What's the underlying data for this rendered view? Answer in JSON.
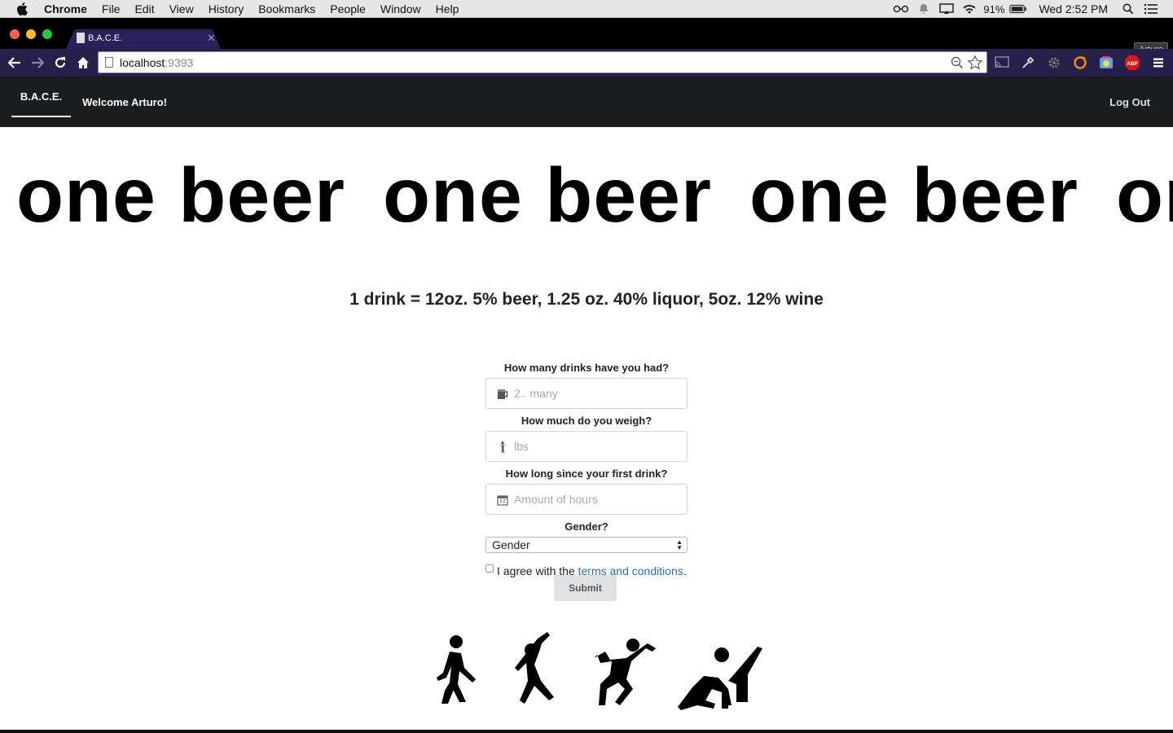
{
  "os_menu": {
    "app": "Chrome",
    "items": [
      "File",
      "Edit",
      "View",
      "History",
      "Bookmarks",
      "People",
      "Window",
      "Help"
    ],
    "battery": "91%",
    "clock": "Wed 2:52 PM"
  },
  "browser": {
    "tab_title": "B.A.C.E.",
    "profile": "Arturo",
    "url_host": "localhost",
    "url_port": ":9393"
  },
  "nav": {
    "brand": "B.A.C.E.",
    "welcome": "Welcome Arturo!",
    "logout": "Log Out"
  },
  "marquee": {
    "text": "one beer"
  },
  "equation": "1 drink = 12oz. 5% beer, 1.25 oz. 40% liquor, 5oz. 12% wine",
  "form": {
    "drinks_label": "How many drinks have you had?",
    "drinks_placeholder": "2.. many",
    "weight_label": "How much do you weigh?",
    "weight_placeholder": "lbs",
    "hours_label": "How long since your first drink?",
    "hours_placeholder": "Amount of hours",
    "gender_label": "Gender?",
    "gender_value": "Gender",
    "agree_text": "I agree with the ",
    "terms_link": "terms and conditions",
    "agree_end": ".",
    "submit": "Submit"
  }
}
